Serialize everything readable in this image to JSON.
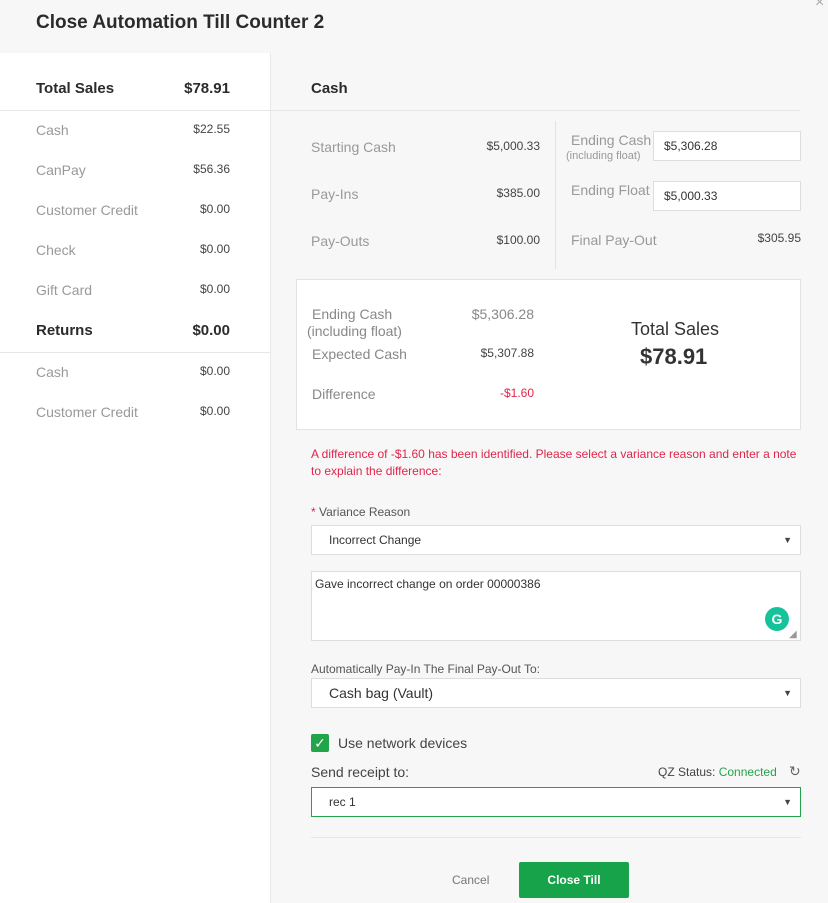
{
  "dialog": {
    "title": "Close Automation Till Counter 2",
    "close_glyph": "×"
  },
  "left": {
    "total_sales": {
      "label": "Total Sales",
      "value": "$78.91"
    },
    "sales_items": [
      {
        "label": "Cash",
        "value": "$22.55"
      },
      {
        "label": "CanPay",
        "value": "$56.36"
      },
      {
        "label": "Customer Credit",
        "value": "$0.00"
      },
      {
        "label": "Check",
        "value": "$0.00"
      },
      {
        "label": "Gift Card",
        "value": "$0.00"
      }
    ],
    "returns": {
      "label": "Returns",
      "value": "$0.00"
    },
    "return_items": [
      {
        "label": "Cash",
        "value": "$0.00"
      },
      {
        "label": "Customer Credit",
        "value": "$0.00"
      }
    ]
  },
  "cash": {
    "section_title": "Cash",
    "starting_cash": {
      "label": "Starting Cash",
      "value": "$5,000.33"
    },
    "pay_ins": {
      "label": "Pay-Ins",
      "value": "$385.00"
    },
    "pay_outs": {
      "label": "Pay-Outs",
      "value": "$100.00"
    },
    "ending_cash": {
      "label": "Ending Cash",
      "sublabel": "(including float)",
      "value": "$5,306.28"
    },
    "ending_float": {
      "label": "Ending Float",
      "value": "$5,000.33"
    },
    "final_payout": {
      "label": "Final Pay-Out",
      "value": "$305.95"
    }
  },
  "summary": {
    "ending_cash": {
      "label": "Ending Cash",
      "sublabel": "(including float)",
      "value": "$5,306.28"
    },
    "expected_cash": {
      "label": "Expected Cash",
      "value": "$5,307.88"
    },
    "difference": {
      "label": "Difference",
      "value": "-$1.60"
    },
    "total_sales_label": "Total Sales",
    "total_sales_value": "$78.91"
  },
  "variance": {
    "warning": "A difference of -$1.60 has been identified. Please select a variance reason and enter a note to explain the difference:",
    "reason_required_mark": "*",
    "reason_label": "Variance Reason",
    "reason_value": "Incorrect Change",
    "note": "Gave incorrect change on order 00000386",
    "grammarly_glyph": "G"
  },
  "payin": {
    "label": "Automatically Pay-In The Final Pay-Out To:",
    "value": "Cash bag  (Vault)"
  },
  "network": {
    "checkbox_label": "Use network devices",
    "checked": true,
    "check_glyph": "✓",
    "send_label": "Send receipt to:",
    "qz_label": "QZ Status:",
    "qz_status": "Connected",
    "receipt_value": "rec 1"
  },
  "caret_glyph": "▼",
  "actions": {
    "cancel": "Cancel",
    "close_till": "Close Till"
  },
  "colors": {
    "accent_green": "#16a34a",
    "error_red": "#e0254a",
    "connected_green": "#22a44a"
  }
}
